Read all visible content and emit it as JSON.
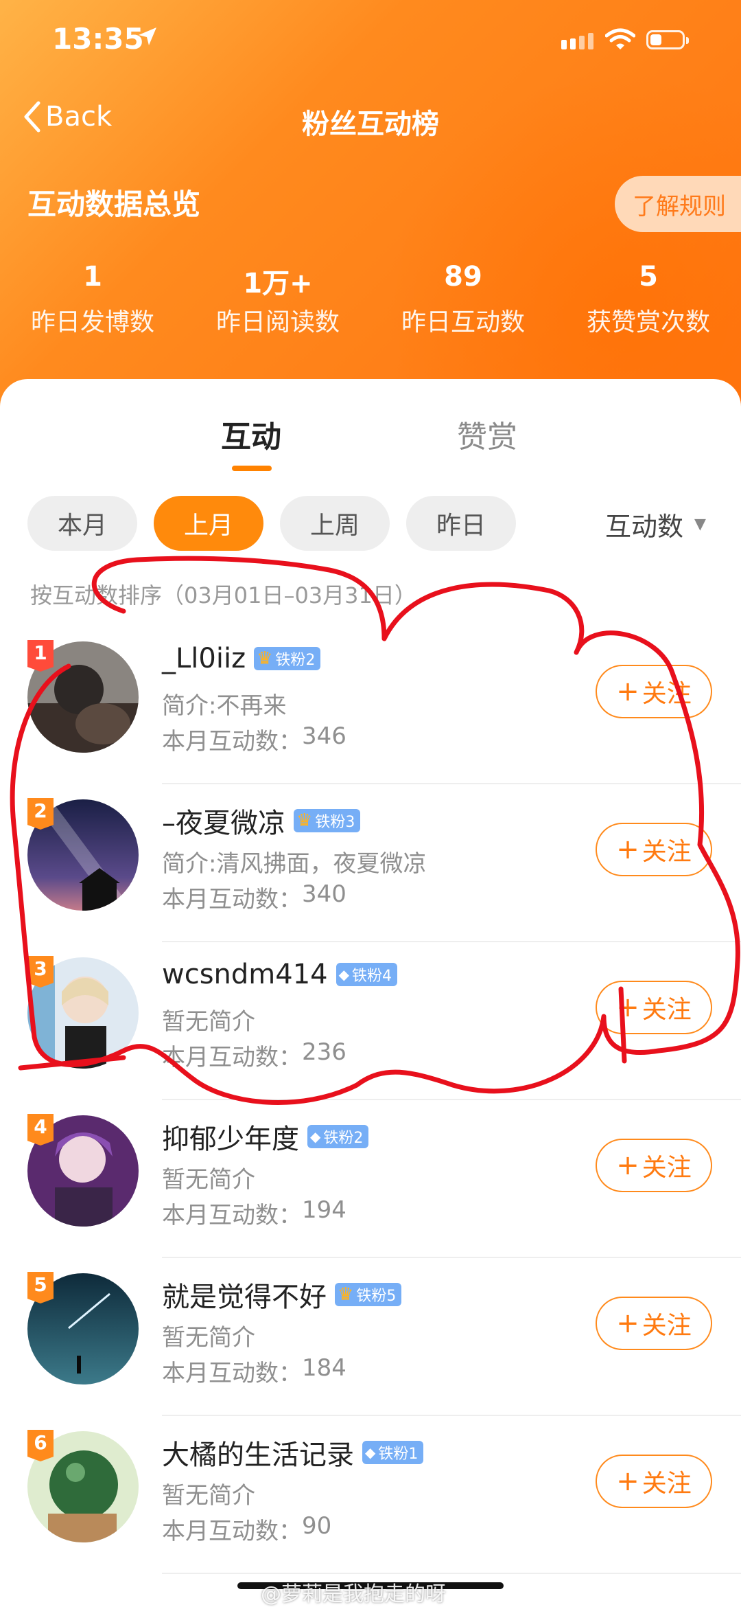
{
  "status_bar": {
    "time": "13:35"
  },
  "nav": {
    "back_label": "Back",
    "title": "粉丝互动榜"
  },
  "overview": {
    "title": "互动数据总览",
    "rules_label": "了解规则",
    "stats": [
      {
        "value": "1",
        "label": "昨日发博数"
      },
      {
        "value": "1万+",
        "label": "昨日阅读数"
      },
      {
        "value": "89",
        "label": "昨日互动数"
      },
      {
        "value": "5",
        "label": "获赞赏次数"
      }
    ]
  },
  "tabs": [
    {
      "label": "互动",
      "active": true
    },
    {
      "label": "赞赏",
      "active": false
    }
  ],
  "filters": [
    {
      "label": "本月",
      "active": false
    },
    {
      "label": "上月",
      "active": true
    },
    {
      "label": "上周",
      "active": false
    },
    {
      "label": "昨日",
      "active": false
    }
  ],
  "sort": {
    "label": "互动数",
    "description": "按互动数排序（03月01日–03月31日）"
  },
  "count_prefix": "本月互动数：",
  "follow_label": "关注",
  "fans": [
    {
      "rank": "1",
      "name": "_Ll0iiz",
      "badge_type": "crown",
      "badge_level": "铁粉2",
      "intro": "简介:不再来",
      "count": "346"
    },
    {
      "rank": "2",
      "name": "–夜夏微凉",
      "badge_type": "crown",
      "badge_level": "铁粉3",
      "intro": "简介:清风拂面，夜夏微凉",
      "count": "340"
    },
    {
      "rank": "3",
      "name": "wcsndm414",
      "badge_type": "diamond",
      "badge_level": "铁粉4",
      "intro": "暂无简介",
      "count": "236"
    },
    {
      "rank": "4",
      "name": "抑郁少年度",
      "badge_type": "diamond",
      "badge_level": "铁粉2",
      "intro": "暂无简介",
      "count": "194"
    },
    {
      "rank": "5",
      "name": "就是觉得不好",
      "badge_type": "crown",
      "badge_level": "铁粉5",
      "intro": "暂无简介",
      "count": "184"
    },
    {
      "rank": "6",
      "name": "大橘的生活记录",
      "badge_type": "diamond",
      "badge_level": "铁粉1",
      "intro": "暂无简介",
      "count": "90"
    }
  ],
  "colors": {
    "accent": "#ff8a0c",
    "annotation": "#e8101c"
  },
  "watermark": "@萝莉是我抱走的呀"
}
